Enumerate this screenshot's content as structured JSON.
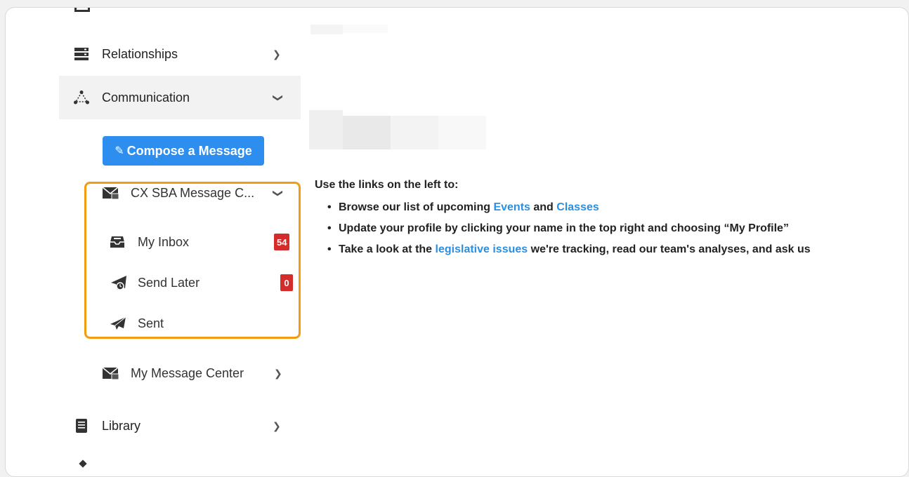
{
  "sidebar": {
    "relationships": "Relationships",
    "communication": "Communication",
    "compose_label": "Compose a Message",
    "message_center_group": "CX SBA Message C...",
    "inbox": {
      "label": "My Inbox",
      "count": "54"
    },
    "send_later": {
      "label": "Send Later",
      "count": "0"
    },
    "sent": {
      "label": "Sent"
    },
    "my_message_center": "My Message Center",
    "library": "Library"
  },
  "content": {
    "intro": "Use the links on the left to:",
    "bullet1": {
      "prefix": "Browse our list of upcoming ",
      "link1": "Events",
      "mid": " and ",
      "link2": "Classes"
    },
    "bullet2": "Update your profile by clicking your name in the top right and choosing “My Profile”",
    "bullet3": {
      "prefix": "Take a look at the ",
      "link": "legislative issues",
      "suffix": " we're tracking, read our team's analyses, and ask us"
    }
  },
  "colors": {
    "accent": "#2d8ef0",
    "highlight": "#f39c12",
    "badge": "#d42b2b",
    "link": "#2b8fe3"
  }
}
